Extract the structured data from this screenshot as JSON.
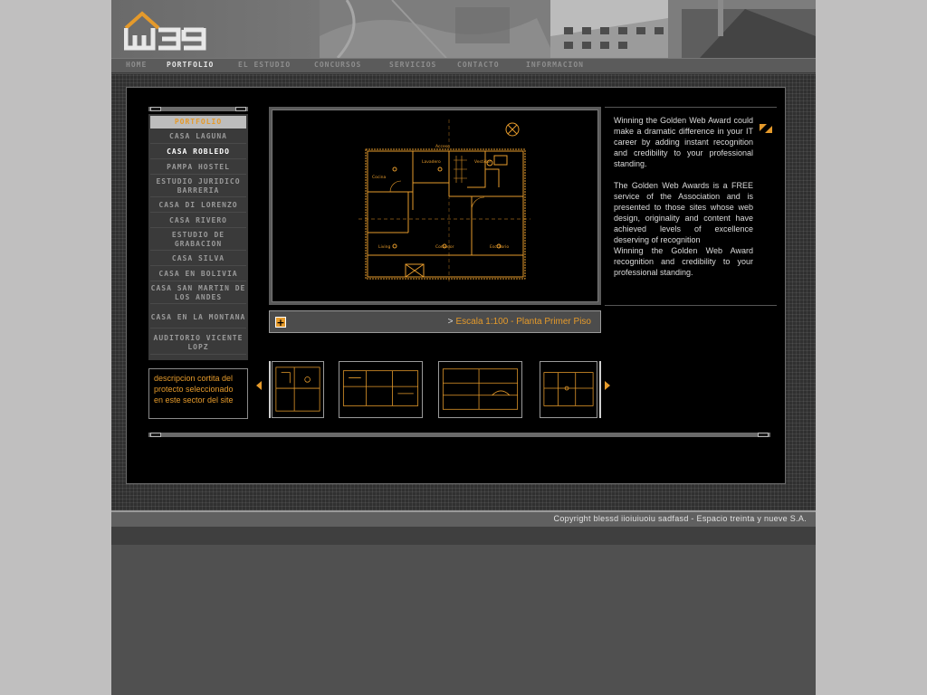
{
  "brand": {
    "logo_text": "W39"
  },
  "nav": {
    "items": [
      {
        "label": "Home"
      },
      {
        "label": "Portfolio"
      },
      {
        "label": "El Estudio"
      },
      {
        "label": "Concursos"
      },
      {
        "label": "Servicios"
      },
      {
        "label": "Contacto"
      },
      {
        "label": "Informacion"
      }
    ],
    "active": "Portfolio"
  },
  "menu": {
    "heading": "Portfolio",
    "items": [
      {
        "label": "Casa Laguna"
      },
      {
        "label": "Casa Robledo"
      },
      {
        "label": "Pampa Hostel"
      },
      {
        "label": "Estudio Juridico Barreria"
      },
      {
        "label": "Casa Di Lorenzo"
      },
      {
        "label": "Casa Rivero"
      },
      {
        "label": "Estudio de Grabacion"
      },
      {
        "label": "Casa Silva"
      },
      {
        "label": "Casa en Bolivia"
      },
      {
        "label": "Casa San Martin de los Andes"
      },
      {
        "label": "Casa en la Montana"
      },
      {
        "label": "Auditorio Vicente Lopz"
      }
    ],
    "active": "Casa Robledo"
  },
  "description": "descripcion cortita del protecto seleccionado en este sector del site",
  "viewer": {
    "caption_arrow": ">",
    "caption": "Escala 1:100 - Planta Primer Piso",
    "expand_symbol": "+"
  },
  "info": {
    "paragraph_1": "Winning the Golden Web Award could make a dramatic difference in your IT career by adding instant recognition and credibility to your professional standing.",
    "paragraph_2": "The Golden Web Awards is a FREE service of the Association and is presented to those sites whose web design, originality and content have achieved levels of excellence deserving of recognition",
    "paragraph_3": "Winning the Golden Web Award recognition and credibility to your professional standing."
  },
  "plan_labels": {
    "acceso": "Acceso",
    "cocina": "Cocina",
    "lavadero": "Lavadero",
    "vestidor": "Vestidor",
    "living": "Living",
    "comedor": "Comedor",
    "escritorio": "Escritorio"
  },
  "footer": {
    "copyright": "Copyright blessd iioiuiuoiu sadfasd - Espacio treinta y nueve S.A."
  },
  "colors": {
    "accent": "#e59a2b",
    "background": "#505050",
    "panel": "#000000"
  }
}
